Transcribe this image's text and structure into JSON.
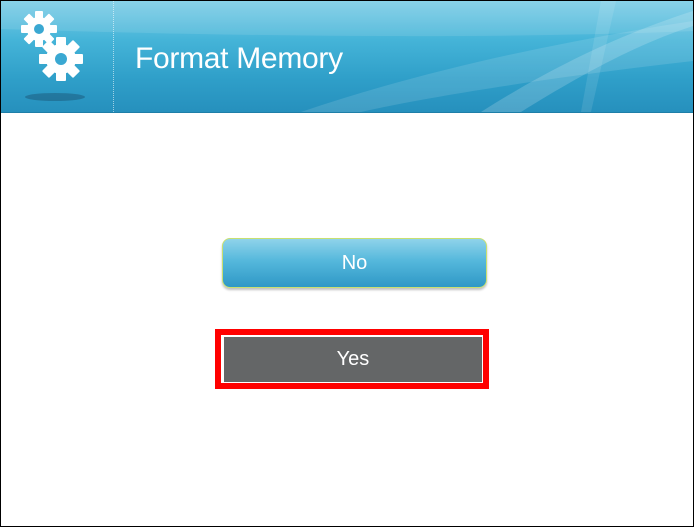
{
  "header": {
    "title": "Format Memory",
    "icon": "gears-icon"
  },
  "dialog": {
    "no_label": "No",
    "yes_label": "Yes",
    "selected": "Yes"
  },
  "colors": {
    "header_blue": "#2f9fc9",
    "button_blue": "#55b8dc",
    "button_gray": "#646667",
    "focus_red": "#ff0000"
  }
}
